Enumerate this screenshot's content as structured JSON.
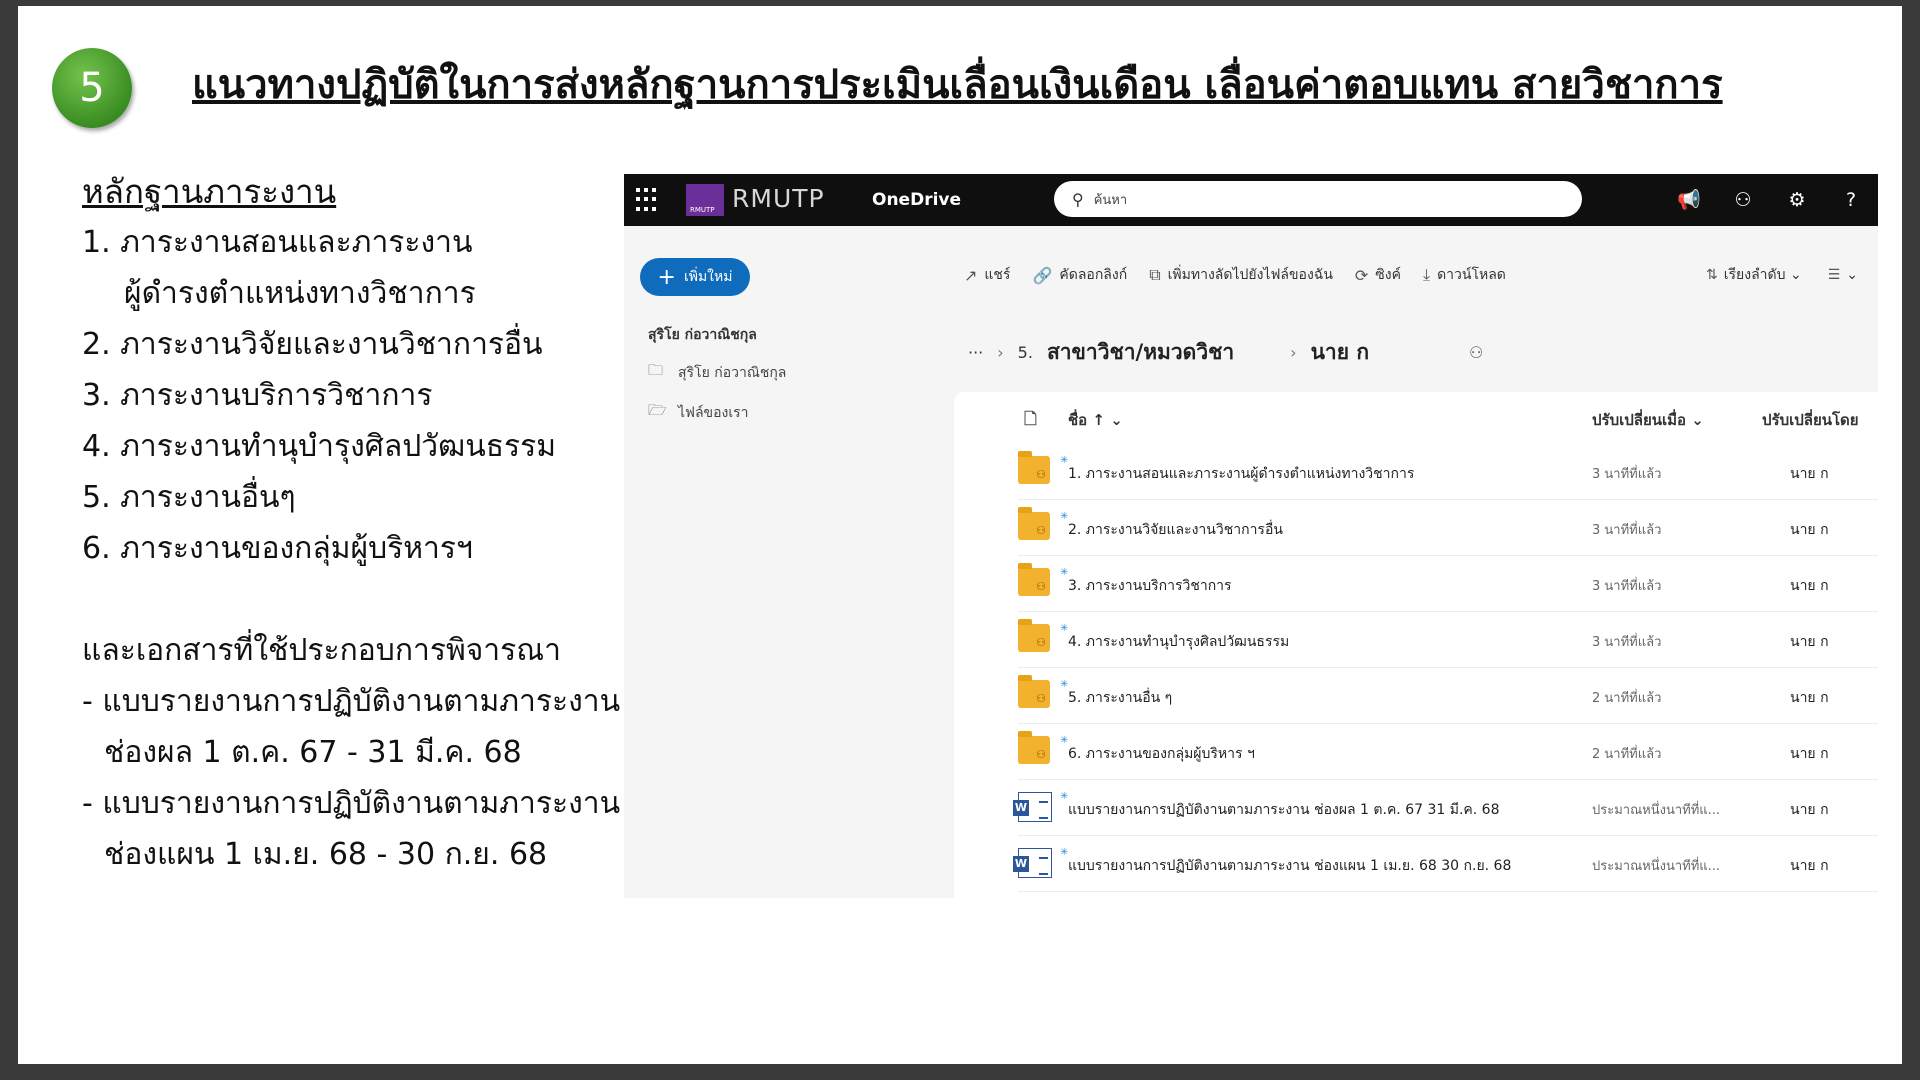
{
  "slide": {
    "number": "5",
    "title": "แนวทางปฏิบัติในการส่งหลักฐานการประเมินเลื่อนเงินเดือน เลื่อนค่าตอบแทน สายวิชาการ",
    "evidence_heading": "หลักฐานภาระงาน",
    "items": [
      "1. ภาระงานสอนและภาระงาน",
      "ผู้ดำรงตำแหน่งทางวิชาการ",
      "2. ภาระงานวิจัยและงานวิชาการอื่น",
      "3. ภาระงานบริการวิชาการ",
      "4. ภาระงานทำนุบำรุงศิลปวัฒนธรรม",
      "5. ภาระงานอื่นๆ",
      "6. ภาระงานของกลุ่มผู้บริหารฯ"
    ],
    "docs_heading": "และเอกสารที่ใช้ประกอบการพิจารณา",
    "docs": [
      "- แบบรายงานการปฏิบัติงานตามภาระงาน",
      "ช่องผล 1 ต.ค. 67 - 31 มี.ค. 68",
      "- แบบรายงานการปฏิบัติงานตามภาระงาน",
      "ช่องแผน 1 เม.ย. 68 - 30 ก.ย. 68"
    ]
  },
  "onedrive": {
    "brand": "RMUTP",
    "logo_small": "RMUTP",
    "app_name": "OneDrive",
    "search_placeholder": "ค้นหา",
    "top_icons": [
      "megaphone-icon",
      "share-people-icon",
      "gear-icon",
      "help-icon"
    ],
    "new_button": "เพิ่มใหม่",
    "commands": [
      "แชร์",
      "คัดลอกลิงก์",
      "เพิ่มทางลัดไปยังไฟล์ของฉัน",
      "ซิงค์",
      "ดาวน์โหลด"
    ],
    "sort_label": "เรียงลำดับ",
    "sidebar": {
      "user": "สุริโย ก่อวาณิชกุล",
      "items": [
        "สุริโย ก่อวาณิชกุล",
        "ไฟล์ของเรา"
      ]
    },
    "breadcrumb": {
      "ellipsis": "···",
      "prefix": "5.",
      "folder": "สาขาวิชา/หมวดวิชา",
      "current": "นาย ก"
    },
    "columns": {
      "name": "ชื่อ ↑",
      "modified": "ปรับเปลี่ยนเมื่อ",
      "modified_by": "ปรับเปลี่ยนโดย"
    },
    "files": [
      {
        "type": "folder",
        "name": "1. ภาระงานสอนและภาระงานผู้ดำรงตำแหน่งทางวิชาการ",
        "modified": "3 นาทีที่แล้ว",
        "by": "นาย ก"
      },
      {
        "type": "folder",
        "name": "2. ภาระงานวิจัยและงานวิชาการอื่น",
        "modified": "3 นาทีที่แล้ว",
        "by": "นาย ก"
      },
      {
        "type": "folder",
        "name": "3. ภาระงานบริการวิชาการ",
        "modified": "3 นาทีที่แล้ว",
        "by": "นาย ก"
      },
      {
        "type": "folder",
        "name": "4. ภาระงานทำนุบำรุงศิลปวัฒนธรรม",
        "modified": "3 นาทีที่แล้ว",
        "by": "นาย ก"
      },
      {
        "type": "folder",
        "name": "5. ภาระงานอื่น ๆ",
        "modified": "2 นาทีที่แล้ว",
        "by": "นาย ก"
      },
      {
        "type": "folder",
        "name": "6. ภาระงานของกลุ่มผู้บริหาร ฯ",
        "modified": "2 นาทีที่แล้ว",
        "by": "นาย ก"
      },
      {
        "type": "word",
        "name": "แบบรายงานการปฏิบัติงานตามภาระงาน ช่องผล 1 ต.ค. 67 31 มี.ค. 68",
        "modified": "ประมาณหนึ่งนาทีที่แ...",
        "by": "นาย ก"
      },
      {
        "type": "word",
        "name": "แบบรายงานการปฏิบัติงานตามภาระงาน ช่องแผน 1 เม.ย. 68 30 ก.ย. 68",
        "modified": "ประมาณหนึ่งนาทีที่แ...",
        "by": "นาย ก"
      }
    ]
  }
}
